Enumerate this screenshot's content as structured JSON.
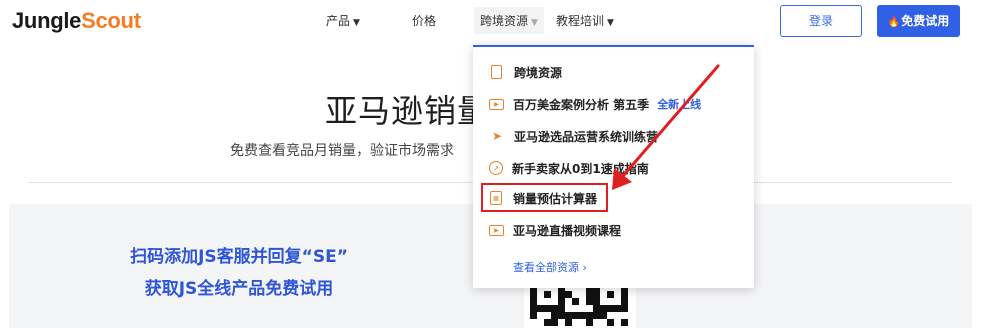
{
  "header": {
    "logo": {
      "part1": "Jungle",
      "part2": "Scout"
    },
    "nav": [
      {
        "label": "产品",
        "caret": "▼"
      },
      {
        "label": "价格"
      },
      {
        "label": "跨境资源",
        "caret": "▼",
        "active": true
      },
      {
        "label": "教程培训",
        "caret": "▼"
      }
    ],
    "login_label": "登录",
    "trial_label": "免费试用",
    "trial_icon": "flame-icon"
  },
  "hero": {
    "title": "亚马逊销量",
    "subtitle": "免费查看竞品月销量，验证市场需求"
  },
  "promo": {
    "line1": "扫码添加JS客服并回复“SE”",
    "line2": "获取JS全线产品免费试用"
  },
  "dropdown": {
    "items": [
      {
        "label": "跨境资源",
        "icon": "document-icon"
      },
      {
        "label": "百万美金案例分析 第五季",
        "badge": "全新上线",
        "icon": "video-icon"
      },
      {
        "label": "亚马逊选品运营系统训练营",
        "icon": "rocket-icon"
      },
      {
        "label": "新手卖家从0到1速成指南",
        "icon": "compass-icon"
      },
      {
        "label": "销量预估计算器",
        "icon": "calculator-icon",
        "highlighted": true
      },
      {
        "label": "亚马逊直播视频课程",
        "icon": "play-icon"
      }
    ],
    "footer_link": "查看全部资源",
    "footer_caret": "›"
  },
  "colors": {
    "accent": "#3060e6",
    "logo_accent": "#f57c22",
    "icon": "#e8852c",
    "annotation": "#e02020"
  }
}
